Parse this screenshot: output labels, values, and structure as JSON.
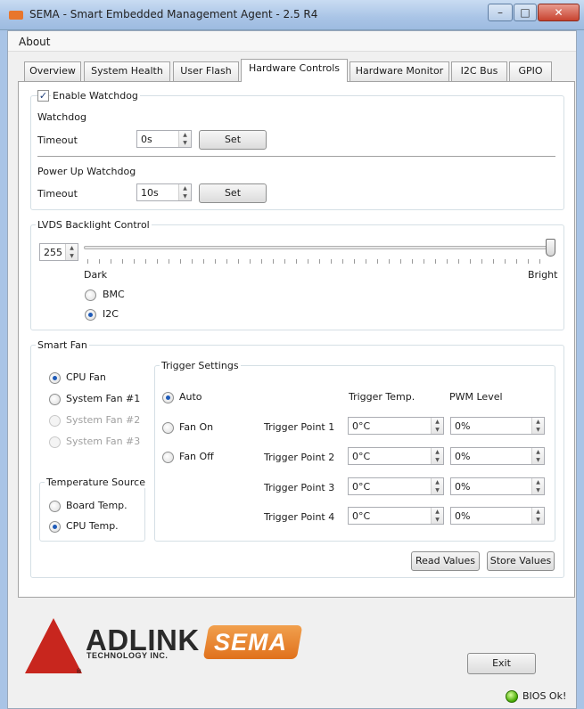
{
  "window": {
    "title": "SEMA - Smart Embedded Management Agent - 2.5 R4",
    "minimize_glyph": "–",
    "maximize_glyph": "□",
    "close_glyph": "✕"
  },
  "menu": {
    "about": "About"
  },
  "tabs": [
    {
      "label": "Overview"
    },
    {
      "label": "System Health"
    },
    {
      "label": "User Flash"
    },
    {
      "label": "Hardware Controls",
      "active": true
    },
    {
      "label": "Hardware Monitor"
    },
    {
      "label": "I2C Bus"
    },
    {
      "label": "GPIO"
    }
  ],
  "watchdog": {
    "enable_label": "Enable Watchdog",
    "enable_checked": true,
    "check_glyph": "✓",
    "watchdog_label": "Watchdog",
    "timeout_label": "Timeout",
    "timeout_value": "0s",
    "set_label": "Set",
    "powerup_label": "Power Up Watchdog",
    "powerup_timeout_label": "Timeout",
    "powerup_timeout_value": "10s",
    "powerup_set_label": "Set"
  },
  "lvds": {
    "group_label": "LVDS Backlight Control",
    "value": "255",
    "level_fraction": 1.0,
    "dark_label": "Dark",
    "bright_label": "Bright",
    "options": [
      {
        "label": "BMC",
        "selected": false
      },
      {
        "label": "I2C",
        "selected": true
      }
    ]
  },
  "smart_fan": {
    "group_label": "Smart Fan",
    "fans": [
      {
        "label": "CPU Fan",
        "selected": true,
        "enabled": true
      },
      {
        "label": "System Fan #1",
        "selected": false,
        "enabled": true
      },
      {
        "label": "System Fan #2",
        "selected": false,
        "enabled": false
      },
      {
        "label": "System Fan #3",
        "selected": false,
        "enabled": false
      }
    ],
    "temp_source": {
      "group_label": "Temperature Source",
      "options": [
        {
          "label": "Board Temp.",
          "selected": false
        },
        {
          "label": "CPU Temp.",
          "selected": true
        }
      ]
    },
    "trigger": {
      "group_label": "Trigger Settings",
      "modes": [
        {
          "label": "Auto",
          "selected": true
        },
        {
          "label": "Fan On",
          "selected": false
        },
        {
          "label": "Fan Off",
          "selected": false
        }
      ],
      "temp_header": "Trigger Temp.",
      "pwm_header": "PWM Level",
      "points": [
        {
          "label": "Trigger Point 1",
          "temp": "0°C",
          "pwm": "0%"
        },
        {
          "label": "Trigger Point 2",
          "temp": "0°C",
          "pwm": "0%"
        },
        {
          "label": "Trigger Point 3",
          "temp": "0°C",
          "pwm": "0%"
        },
        {
          "label": "Trigger Point 4",
          "temp": "0°C",
          "pwm": "0%"
        }
      ]
    },
    "read_label": "Read Values",
    "store_label": "Store Values"
  },
  "spin_up_glyph": "▲",
  "spin_down_glyph": "▼",
  "footer": {
    "adlink_word": "ADLINK",
    "adlink_sub": "TECHNOLOGY INC.",
    "adlink_mark": "®",
    "sema_word": "SEMA",
    "exit_label": "Exit",
    "bios_status": "BIOS Ok!"
  },
  "colors": {
    "accent": "#1f5bb8",
    "adlink_red": "#c8261e",
    "sema_orange": "#e0711c",
    "status_green": "#44a800"
  }
}
